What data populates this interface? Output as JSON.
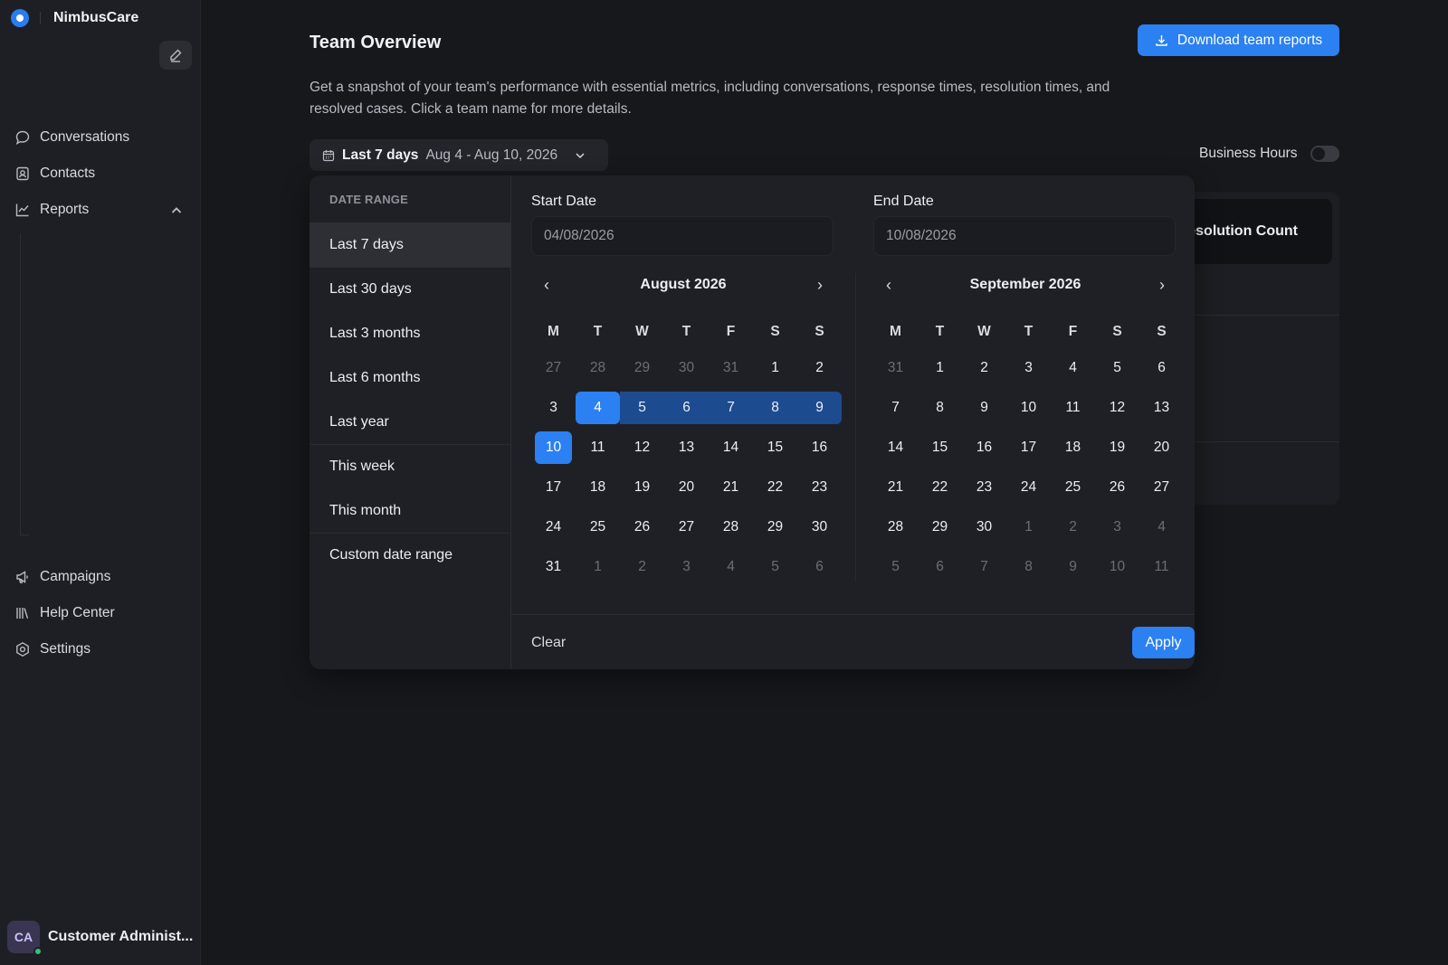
{
  "app": {
    "name": "NimbusCare"
  },
  "sidebar": {
    "items": [
      {
        "label": "Conversations",
        "icon": "chat-bubble-icon"
      },
      {
        "label": "Contacts",
        "icon": "contact-card-icon"
      },
      {
        "label": "Reports",
        "icon": "line-chart-icon",
        "expanded": true
      },
      {
        "label": "Campaigns",
        "icon": "megaphone-icon"
      },
      {
        "label": "Help Center",
        "icon": "library-icon"
      },
      {
        "label": "Settings",
        "icon": "gear-icon"
      }
    ],
    "user": {
      "initials": "CA",
      "name": "Customer Administ...",
      "status": "online"
    }
  },
  "header": {
    "title": "Team Overview",
    "download_label": "Download team reports",
    "description": "Get a snapshot of your team's performance with essential metrics, including conversations, response times, resolution times, and resolved cases. Click a team name for more details."
  },
  "filter": {
    "range_label": "Last 7 days",
    "range_dates": "Aug 4 - Aug 10, 2026",
    "business_hours_label": "Business Hours",
    "business_hours_on": false
  },
  "background_card": {
    "header": "Resolution Count"
  },
  "picker": {
    "presets_title": "DATE RANGE",
    "presets": [
      "Last 7 days",
      "Last 30 days",
      "Last 3 months",
      "Last 6 months",
      "Last year",
      "This week",
      "This month",
      "Custom date range"
    ],
    "active_preset": 0,
    "start_label": "Start Date",
    "start_value": "04/08/2026",
    "end_label": "End Date",
    "end_value": "10/08/2026",
    "weekdays": [
      "M",
      "T",
      "W",
      "T",
      "F",
      "S",
      "S"
    ],
    "months": [
      {
        "title": "August 2026",
        "days": [
          [
            27,
            true
          ],
          [
            28,
            true
          ],
          [
            29,
            true
          ],
          [
            30,
            true
          ],
          [
            31,
            true
          ],
          [
            1,
            false
          ],
          [
            2,
            false
          ],
          [
            3,
            false
          ],
          [
            4,
            false
          ],
          [
            5,
            false
          ],
          [
            6,
            false
          ],
          [
            7,
            false
          ],
          [
            8,
            false
          ],
          [
            9,
            false
          ],
          [
            10,
            false
          ],
          [
            11,
            false
          ],
          [
            12,
            false
          ],
          [
            13,
            false
          ],
          [
            14,
            false
          ],
          [
            15,
            false
          ],
          [
            16,
            false
          ],
          [
            17,
            false
          ],
          [
            18,
            false
          ],
          [
            19,
            false
          ],
          [
            20,
            false
          ],
          [
            21,
            false
          ],
          [
            22,
            false
          ],
          [
            23,
            false
          ],
          [
            24,
            false
          ],
          [
            25,
            false
          ],
          [
            26,
            false
          ],
          [
            27,
            false
          ],
          [
            28,
            false
          ],
          [
            29,
            false
          ],
          [
            30,
            false
          ],
          [
            31,
            false
          ],
          [
            1,
            true
          ],
          [
            2,
            true
          ],
          [
            3,
            true
          ],
          [
            4,
            true
          ],
          [
            5,
            true
          ],
          [
            6,
            true
          ]
        ],
        "range_start": 8,
        "range_end": 13,
        "today": 14
      },
      {
        "title": "September 2026",
        "days": [
          [
            31,
            true
          ],
          [
            1,
            false
          ],
          [
            2,
            false
          ],
          [
            3,
            false
          ],
          [
            4,
            false
          ],
          [
            5,
            false
          ],
          [
            6,
            false
          ],
          [
            7,
            false
          ],
          [
            8,
            false
          ],
          [
            9,
            false
          ],
          [
            10,
            false
          ],
          [
            11,
            false
          ],
          [
            12,
            false
          ],
          [
            13,
            false
          ],
          [
            14,
            false
          ],
          [
            15,
            false
          ],
          [
            16,
            false
          ],
          [
            17,
            false
          ],
          [
            18,
            false
          ],
          [
            19,
            false
          ],
          [
            20,
            false
          ],
          [
            21,
            false
          ],
          [
            22,
            false
          ],
          [
            23,
            false
          ],
          [
            24,
            false
          ],
          [
            25,
            false
          ],
          [
            26,
            false
          ],
          [
            27,
            false
          ],
          [
            28,
            false
          ],
          [
            29,
            false
          ],
          [
            30,
            false
          ],
          [
            1,
            true
          ],
          [
            2,
            true
          ],
          [
            3,
            true
          ],
          [
            4,
            true
          ],
          [
            5,
            true
          ],
          [
            6,
            true
          ],
          [
            7,
            true
          ],
          [
            8,
            true
          ],
          [
            9,
            true
          ],
          [
            10,
            true
          ],
          [
            11,
            true
          ]
        ]
      }
    ],
    "clear_label": "Clear",
    "apply_label": "Apply"
  },
  "colors": {
    "accent": "#2b80f2",
    "range": "#1d4b8f",
    "background": "#17181c",
    "sidebar": "#1e1f24"
  }
}
